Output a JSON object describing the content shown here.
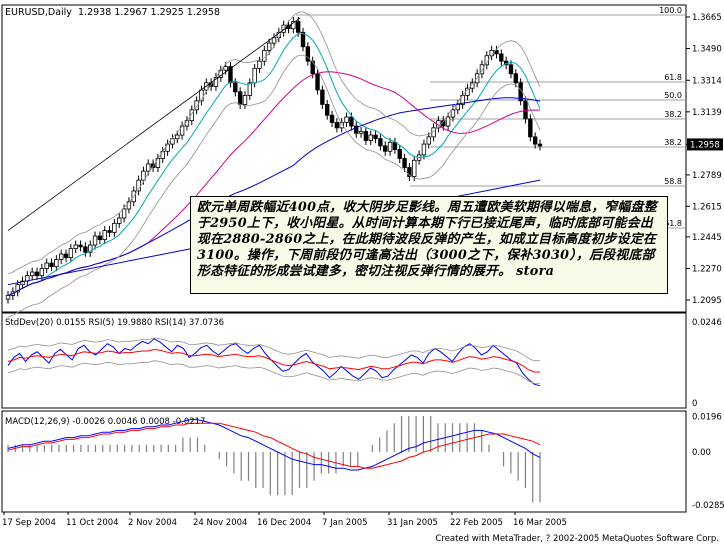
{
  "chart_title": "EURUSD,Daily",
  "ohlc_header": "1.2938 1.2967 1.2925 1.2958",
  "main_price_ticks": [
    "1.3665",
    "1.3490",
    "1.3314",
    "1.3139",
    "1.2958",
    "1.2789",
    "1.2615",
    "1.2445",
    "1.2270",
    "1.2095"
  ],
  "current_price_label": "1.2958",
  "fibo_labels": [
    "100.0",
    "61.8",
    "50.0",
    "38.2",
    "38.2",
    "58.8",
    "61.8"
  ],
  "annotation": "欧元单周跌幅近400点，收大阴步足影线。周五遭欧美软期得以喘息，窄幅盘整于2950上下，收小阳星。从时间计算本期下行已接近尾声，临时底部可能会出现在2880-2860之上，在此期待波段反弹的产生，如成立目标高度初步设定在3100。操作，下周前段仍可逢高沽出（3000之下，保补3030），后段视底部形态特征的形成尝试建多，密切注视反弹行情的展开。 stora",
  "indicator1": {
    "label": "StdDev(20) 0.0155  RSI(5) 19.9880  RSI(14) 37.0736",
    "ticks": [
      "0.0246",
      "0"
    ]
  },
  "indicator2": {
    "label": "MACD(12,26,9) -0.0026 0.0046 0.0008 -0.0217",
    "ticks": [
      "0.0196",
      "0.00",
      "-0.0285"
    ]
  },
  "date_labels": [
    "17 Sep 2004",
    "11 Oct 2004",
    "2 Nov 2004",
    "24 Nov 2004",
    "16 Dec 2004",
    "7 Jan 2005",
    "31 Jan 2005",
    "22 Feb 2005",
    "16 Mar 2005"
  ],
  "footer": "Created with MetaTrader, ? 2002-2005 MetaQuotes Software Corp.",
  "colors": {
    "background": "#ffffff",
    "candle": "#000000",
    "ma_fast": "#00aab4",
    "ma_slow": "#d4008a",
    "ma_long": "#0000cc",
    "bands": "#909090",
    "macd_line": "#0000ff",
    "signal_line": "#ff0000",
    "grid": "#000000"
  },
  "chart_data": {
    "type": "candlestick",
    "symbol": "EURUSD",
    "timeframe": "Daily",
    "ylim": [
      1.2095,
      1.3665
    ],
    "close": [
      1.212,
      1.214,
      1.218,
      1.22,
      1.223,
      1.225,
      1.223,
      1.227,
      1.23,
      1.228,
      1.232,
      1.235,
      1.233,
      1.238,
      1.24,
      1.239,
      1.236,
      1.24,
      1.245,
      1.243,
      1.248,
      1.247,
      1.252,
      1.255,
      1.26,
      1.264,
      1.27,
      1.276,
      1.281,
      1.285,
      1.283,
      1.288,
      1.292,
      1.296,
      1.299,
      1.301,
      1.306,
      1.309,
      1.315,
      1.32,
      1.326,
      1.33,
      1.328,
      1.333,
      1.337,
      1.339,
      1.33,
      1.325,
      1.318,
      1.323,
      1.33,
      1.338,
      1.342,
      1.348,
      1.352,
      1.355,
      1.358,
      1.362,
      1.36,
      1.364,
      1.358,
      1.35,
      1.342,
      1.335,
      1.326,
      1.318,
      1.312,
      1.308,
      1.305,
      1.308,
      1.311,
      1.306,
      1.302,
      1.303,
      1.298,
      1.301,
      1.299,
      1.295,
      1.292,
      1.297,
      1.293,
      1.288,
      1.283,
      1.278,
      1.287,
      1.29,
      1.296,
      1.3,
      1.305,
      1.309,
      1.306,
      1.311,
      1.315,
      1.318,
      1.323,
      1.327,
      1.33,
      1.335,
      1.34,
      1.345,
      1.348,
      1.346,
      1.342,
      1.34,
      1.335,
      1.33,
      1.32,
      1.31,
      1.3,
      1.296,
      1.295
    ],
    "rsi5": [
      45,
      55,
      60,
      50,
      58,
      62,
      55,
      48,
      60,
      65,
      58,
      52,
      66,
      70,
      62,
      58,
      65,
      72,
      68,
      60,
      66,
      64,
      70,
      75,
      72,
      78,
      74,
      68,
      62,
      70,
      66,
      55,
      60,
      67,
      70,
      63,
      58,
      64,
      70,
      72,
      65,
      60,
      66,
      70,
      60,
      52,
      45,
      38,
      40,
      48,
      55,
      60,
      50,
      44,
      38,
      30,
      36,
      44,
      38,
      32,
      28,
      35,
      42,
      38,
      30,
      32,
      40,
      46,
      52,
      58,
      55,
      48,
      60,
      66,
      62,
      56,
      50,
      60,
      68,
      72,
      66,
      58,
      62,
      70,
      64,
      58,
      52,
      48,
      36,
      28,
      22,
      20
    ],
    "rsi14": [
      50,
      52,
      55,
      54,
      56,
      57,
      56,
      55,
      57,
      59,
      58,
      57,
      60,
      62,
      61,
      60,
      61,
      63,
      62,
      60,
      61,
      61,
      62,
      63,
      63,
      65,
      64,
      62,
      60,
      61,
      60,
      57,
      57,
      58,
      59,
      58,
      56,
      57,
      58,
      59,
      57,
      56,
      56,
      57,
      55,
      52,
      49,
      46,
      45,
      46,
      48,
      50,
      48,
      46,
      44,
      41,
      42,
      43,
      42,
      41,
      40,
      42,
      44,
      43,
      41,
      41,
      43,
      45,
      47,
      49,
      49,
      47,
      50,
      52,
      52,
      51,
      49,
      51,
      54,
      56,
      55,
      53,
      54,
      56,
      55,
      53,
      51,
      49,
      45,
      40,
      37,
      37
    ],
    "macd": [
      0.002,
      0.003,
      0.004,
      0.004,
      0.005,
      0.006,
      0.006,
      0.007,
      0.008,
      0.008,
      0.009,
      0.009,
      0.01,
      0.011,
      0.011,
      0.012,
      0.012,
      0.013,
      0.013,
      0.014,
      0.014,
      0.015,
      0.015,
      0.016,
      0.017,
      0.018,
      0.018,
      0.017,
      0.016,
      0.015,
      0.013,
      0.011,
      0.009,
      0.008,
      0.006,
      0.004,
      0.002,
      0.0,
      -0.002,
      -0.004,
      -0.005,
      -0.006,
      -0.007,
      -0.007,
      -0.008,
      -0.009,
      -0.009,
      -0.01,
      -0.01,
      -0.009,
      -0.008,
      -0.006,
      -0.004,
      -0.002,
      0.0,
      0.002,
      0.003,
      0.005,
      0.006,
      0.007,
      0.008,
      0.009,
      0.01,
      0.011,
      0.012,
      0.012,
      0.011,
      0.01,
      0.008,
      0.006,
      0.004,
      0.002,
      -0.001,
      -0.003
    ],
    "signal": [
      0.001,
      0.002,
      0.003,
      0.003,
      0.004,
      0.005,
      0.005,
      0.006,
      0.007,
      0.007,
      0.008,
      0.008,
      0.009,
      0.01,
      0.01,
      0.011,
      0.011,
      0.012,
      0.012,
      0.013,
      0.013,
      0.014,
      0.014,
      0.015,
      0.015,
      0.016,
      0.016,
      0.016,
      0.016,
      0.016,
      0.015,
      0.014,
      0.013,
      0.012,
      0.011,
      0.009,
      0.008,
      0.006,
      0.004,
      0.002,
      0.0,
      -0.001,
      -0.003,
      -0.004,
      -0.005,
      -0.006,
      -0.007,
      -0.008,
      -0.008,
      -0.009,
      -0.009,
      -0.008,
      -0.007,
      -0.006,
      -0.005,
      -0.003,
      -0.002,
      0.0,
      0.001,
      0.003,
      0.004,
      0.005,
      0.006,
      0.007,
      0.008,
      0.009,
      0.01,
      0.01,
      0.01,
      0.009,
      0.008,
      0.007,
      0.006,
      0.004
    ]
  }
}
